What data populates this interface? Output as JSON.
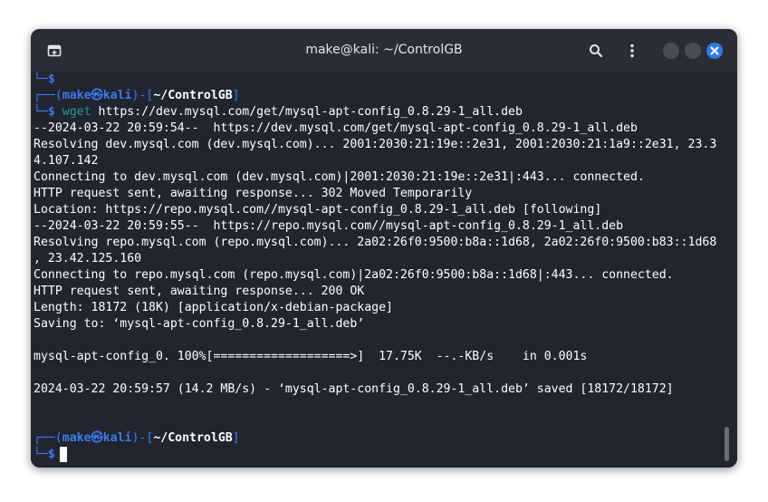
{
  "window": {
    "title": "make@kali: ~/ControlGB"
  },
  "icons": {
    "new_tab": "new-tab-icon",
    "search": "search-icon",
    "menu": "kebab-menu-icon",
    "minimize": "minimize-icon",
    "maximize": "maximize-icon",
    "close": "close-icon"
  },
  "colors": {
    "background": "#212530",
    "titlebar": "#2a2d36",
    "prompt_blue": "#3c7aee",
    "command_teal": "#2a9a98",
    "close_button": "#2f7ae5"
  },
  "terminal": {
    "prev_prompt_end": "└─$",
    "prompt1": {
      "open": "┌──(",
      "user_host": "make㉿kali",
      "mid": ")-[",
      "cwd": "~/ControlGB",
      "close": "]",
      "marker": "└─$",
      "cmd": "wget",
      "args": "https://dev.mysql.com/get/mysql-apt-config_0.8.29-1_all.deb"
    },
    "output": [
      "--2024-03-22 20:59:54--  https://dev.mysql.com/get/mysql-apt-config_0.8.29-1_all.deb",
      "Resolving dev.mysql.com (dev.mysql.com)... 2001:2030:21:19e::2e31, 2001:2030:21:1a9::2e31, 23.3",
      "4.107.142",
      "Connecting to dev.mysql.com (dev.mysql.com)|2001:2030:21:19e::2e31|:443... connected.",
      "HTTP request sent, awaiting response... 302 Moved Temporarily",
      "Location: https://repo.mysql.com//mysql-apt-config_0.8.29-1_all.deb [following]",
      "--2024-03-22 20:59:55--  https://repo.mysql.com//mysql-apt-config_0.8.29-1_all.deb",
      "Resolving repo.mysql.com (repo.mysql.com)... 2a02:26f0:9500:b8a::1d68, 2a02:26f0:9500:b83::1d68",
      ", 23.42.125.160",
      "Connecting to repo.mysql.com (repo.mysql.com)|2a02:26f0:9500:b8a::1d68|:443... connected.",
      "HTTP request sent, awaiting response... 200 OK",
      "Length: 18172 (18K) [application/x-debian-package]",
      "Saving to: ‘mysql-apt-config_0.8.29-1_all.deb’",
      "",
      "mysql-apt-config_0. 100%[===================>]  17.75K  --.-KB/s    in 0.001s",
      "",
      "2024-03-22 20:59:57 (14.2 MB/s) - ‘mysql-apt-config_0.8.29-1_all.deb’ saved [18172/18172]",
      "",
      ""
    ],
    "prompt2": {
      "open": "┌──(",
      "user_host": "make㉿kali",
      "mid": ")-[",
      "cwd": "~/ControlGB",
      "close": "]",
      "marker": "└─$"
    }
  }
}
